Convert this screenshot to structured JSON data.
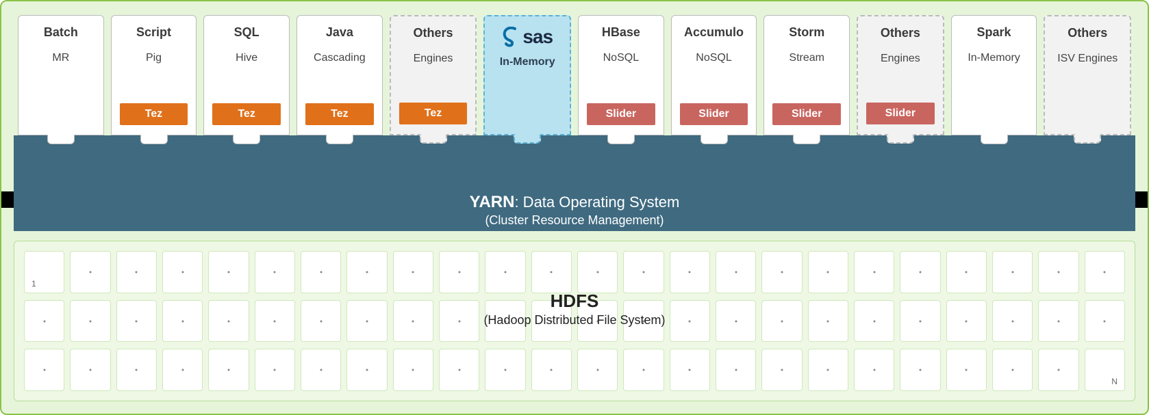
{
  "cards": [
    {
      "title": "Batch",
      "subtitle": "MR",
      "badge": null,
      "style": "solid"
    },
    {
      "title": "Script",
      "subtitle": "Pig",
      "badge": "Tez",
      "style": "solid"
    },
    {
      "title": "SQL",
      "subtitle": "Hive",
      "badge": "Tez",
      "style": "solid"
    },
    {
      "title": "Java",
      "subtitle": "Cascading",
      "badge": "Tez",
      "style": "solid"
    },
    {
      "title": "Others",
      "subtitle": "Engines",
      "badge": "Tez",
      "style": "dashed"
    },
    {
      "title": "",
      "subtitle": "In-Memory",
      "badge": null,
      "style": "sas",
      "logo_text": "sas"
    },
    {
      "title": "HBase",
      "subtitle": "NoSQL",
      "badge": "Slider",
      "style": "solid"
    },
    {
      "title": "Accumulo",
      "subtitle": "NoSQL",
      "badge": "Slider",
      "style": "solid"
    },
    {
      "title": "Storm",
      "subtitle": "Stream",
      "badge": "Slider",
      "style": "solid"
    },
    {
      "title": "Others",
      "subtitle": "Engines",
      "badge": "Slider",
      "style": "dashed"
    },
    {
      "title": "Spark",
      "subtitle": "In-Memory",
      "badge": null,
      "style": "solid"
    },
    {
      "title": "Others",
      "subtitle": "ISV Engines",
      "badge": null,
      "style": "dashed"
    }
  ],
  "yarn": {
    "title": "YARN",
    "tagline": ": Data Operating System",
    "subtitle": "(Cluster Resource Management)"
  },
  "hdfs": {
    "title": "HDFS",
    "subtitle": "(Hadoop Distributed File System)",
    "first_label": "1",
    "last_label": "N",
    "rows": 3,
    "cols": 24
  },
  "colors": {
    "tez": "#e0701a",
    "slider": "#c9655f",
    "yarn_bg": "#3f6a80",
    "frame_bg": "#e6f5d9",
    "frame_border": "#8bc34a",
    "sas_bg": "#b9e2f0",
    "sas_border": "#5bb2d6"
  }
}
